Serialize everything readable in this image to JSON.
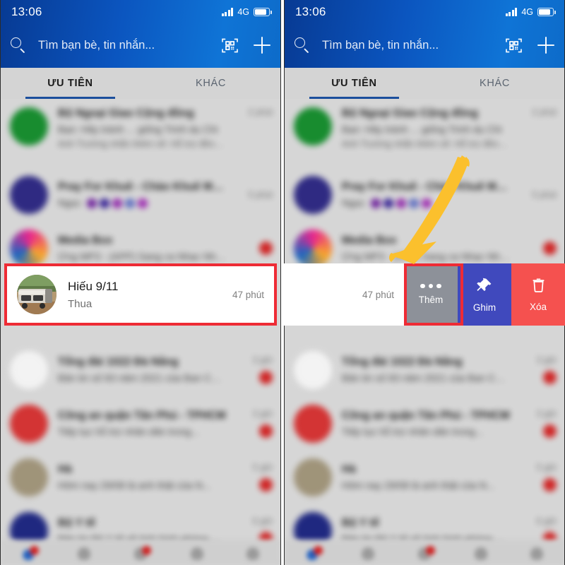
{
  "app": {
    "name": "Zalo",
    "accent_blue": "#0b55bf",
    "highlight_red": "#ee2b35",
    "arrow_color": "#fbc02d"
  },
  "status_bar": {
    "time": "13:06",
    "network": "4G",
    "signal_icon": "signal-bars-icon",
    "battery_icon": "battery-icon"
  },
  "header": {
    "search_icon": "search-icon",
    "search_placeholder": "Tìm bạn bè, tin nhắn...",
    "search_value": "",
    "qr_icon": "qr-code-icon",
    "add_icon": "plus-icon"
  },
  "tabs": [
    {
      "label": "ƯU TIÊN",
      "active": true
    },
    {
      "label": "KHÁC",
      "active": false
    }
  ],
  "selected_chat": {
    "name": "Hiếu 9/11",
    "message": "Thua",
    "time": "47 phút",
    "avatar_icon": "photo-avatar"
  },
  "swipe_actions": [
    {
      "label": "Thêm",
      "icon": "ellipsis-icon",
      "color": "#8d9199",
      "highlighted": true
    },
    {
      "label": "Ghim",
      "icon": "pin-icon",
      "color": "#4049bd",
      "highlighted": false
    },
    {
      "label": "Xóa",
      "icon": "trash-icon",
      "color": "#f5514f",
      "highlighted": false
    }
  ],
  "chats_above": [
    {
      "title": "Bộ Ngoại Giao Cộng đồng",
      "sub": "Bạn: Hãy tránh ... giống Trinh dụ Chi",
      "sub2": "Anh Trường nhắn thêm về: Hỗ trợ đồng bào miền trung",
      "time": "2 phút",
      "avatar_color": "#128a2a",
      "badge": false
    },
    {
      "title": "Pray For Khuê - Chào Khuê Mau...",
      "sub": "Ngọc",
      "sub2": "",
      "time": "5 phút",
      "avatar_color": "#2a2580",
      "badge": false,
      "emoji_blobs": [
        "#6a1b9a",
        "#311b92",
        "#8e24aa",
        "#5c6bc0",
        "#9c27b0"
      ]
    },
    {
      "title": "Media Box",
      "sub": "Ứng MP3 - (APP) Sang ca Nhạc Nhất tại...",
      "sub2": "",
      "time": "",
      "avatar_color": "#e91e8c",
      "badge": true
    }
  ],
  "chats_below": [
    {
      "title": "Tổng đài 1022 Đà Nẵng",
      "sub": "Bản tin số 83 năm 2021 của Ban Chỉ...",
      "time": "3 giờ",
      "avatar_color": "#c62828",
      "badge": true
    },
    {
      "title": "Công an quận Tân Phú - TPHCM",
      "sub": "Tiếp tục hỗ trợ nhân dân trong...",
      "time": "3 giờ",
      "avatar_color": "#d32f2f",
      "badge": true
    },
    {
      "title": "Hà",
      "sub": "Hôm nay 29/08 là anh thật của N...",
      "time": "5 giờ",
      "avatar_color": "#9e9277",
      "badge": true
    },
    {
      "title": "Bộ Y tế",
      "sub": "Bản tin Bộ Y tế về tình hình phòng dịch...",
      "time": "6 giờ",
      "avatar_color": "#1a237e",
      "badge": true
    }
  ],
  "bottom_nav": [
    {
      "icon": "contacts-icon",
      "badge": true
    },
    {
      "icon": "discover-icon",
      "badge": false
    },
    {
      "icon": "diary-icon",
      "badge": true
    },
    {
      "icon": "shop-icon",
      "badge": false
    },
    {
      "icon": "profile-icon",
      "badge": false
    }
  ]
}
